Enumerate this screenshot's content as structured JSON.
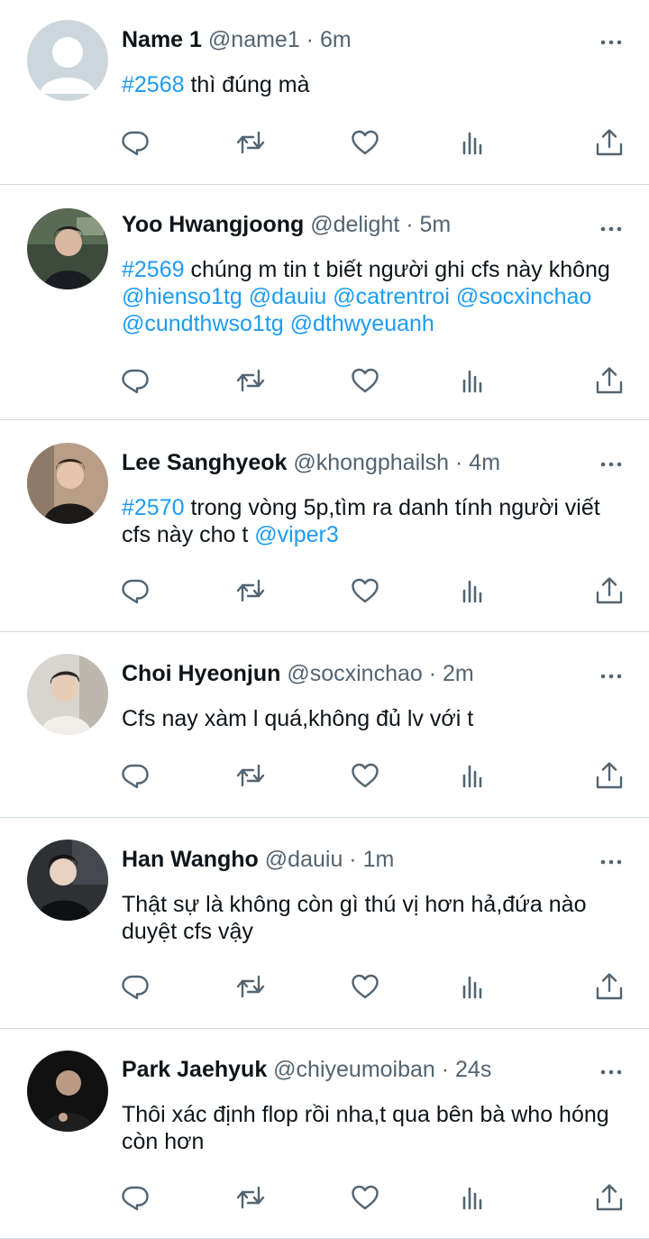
{
  "colors": {
    "link": "#1d9bf0",
    "meta": "#536471",
    "text": "#0f1419",
    "divider": "#cfd9de",
    "icon": "#536471"
  },
  "icons": {
    "more": "more-dots-icon",
    "reply": "reply-icon",
    "retweet": "retweet-icon",
    "like": "heart-icon",
    "views": "views-icon",
    "share": "share-icon"
  },
  "tweets": [
    {
      "name": "Name 1",
      "handle": "@name1",
      "sep": " · ",
      "time": "6m",
      "avatar": "default",
      "content": [
        {
          "t": "#2568",
          "link": true
        },
        {
          "t": " thì đúng mà",
          "link": false
        }
      ]
    },
    {
      "name": "Yoo Hwangjoong",
      "handle": "@delight",
      "sep": " · ",
      "time": "5m",
      "avatar": "photo",
      "content": [
        {
          "t": "#2569",
          "link": true
        },
        {
          "t": " chúng m tin t biết người ghi cfs này không ",
          "link": false
        },
        {
          "t": "@hienso1tg",
          "link": true
        },
        {
          "t": " ",
          "link": false
        },
        {
          "t": "@dauiu",
          "link": true
        },
        {
          "t": " ",
          "link": false
        },
        {
          "t": "@catrentroi",
          "link": true
        },
        {
          "t": " ",
          "link": false
        },
        {
          "t": "@socxinchao",
          "link": true
        },
        {
          "t": " ",
          "link": false
        },
        {
          "t": "@cundthwso1tg",
          "link": true
        },
        {
          "t": " ",
          "link": false
        },
        {
          "t": "@dthwyeuanh",
          "link": true
        }
      ]
    },
    {
      "name": "Lee Sanghyeok",
      "handle": "@khongphailsh",
      "sep": " · ",
      "time": "4m",
      "avatar": "photo",
      "content": [
        {
          "t": "#2570",
          "link": true
        },
        {
          "t": " trong vòng 5p,tìm ra danh tính người viết cfs này cho t ",
          "link": false
        },
        {
          "t": "@viper3",
          "link": true
        }
      ]
    },
    {
      "name": "Choi Hyeonjun",
      "handle": "@socxinchao",
      "sep": " · ",
      "time": "2m",
      "avatar": "photo",
      "content": [
        {
          "t": "Cfs nay xàm l quá,không đủ lv với t",
          "link": false
        }
      ]
    },
    {
      "name": "Han Wangho",
      "handle": "@dauiu",
      "sep": " · ",
      "time": "1m",
      "avatar": "photo",
      "content": [
        {
          "t": "Thật sự là không còn gì thú vị hơn hả,đứa nào duyệt cfs vậy",
          "link": false
        }
      ]
    },
    {
      "name": "Park Jaehyuk",
      "handle": "@chiyeumoiban",
      "sep": " · ",
      "time": "24s",
      "avatar": "photo",
      "content": [
        {
          "t": "Thôi xác định flop rồi nha,t qua bên bà who hóng còn hơn",
          "link": false
        }
      ]
    }
  ]
}
